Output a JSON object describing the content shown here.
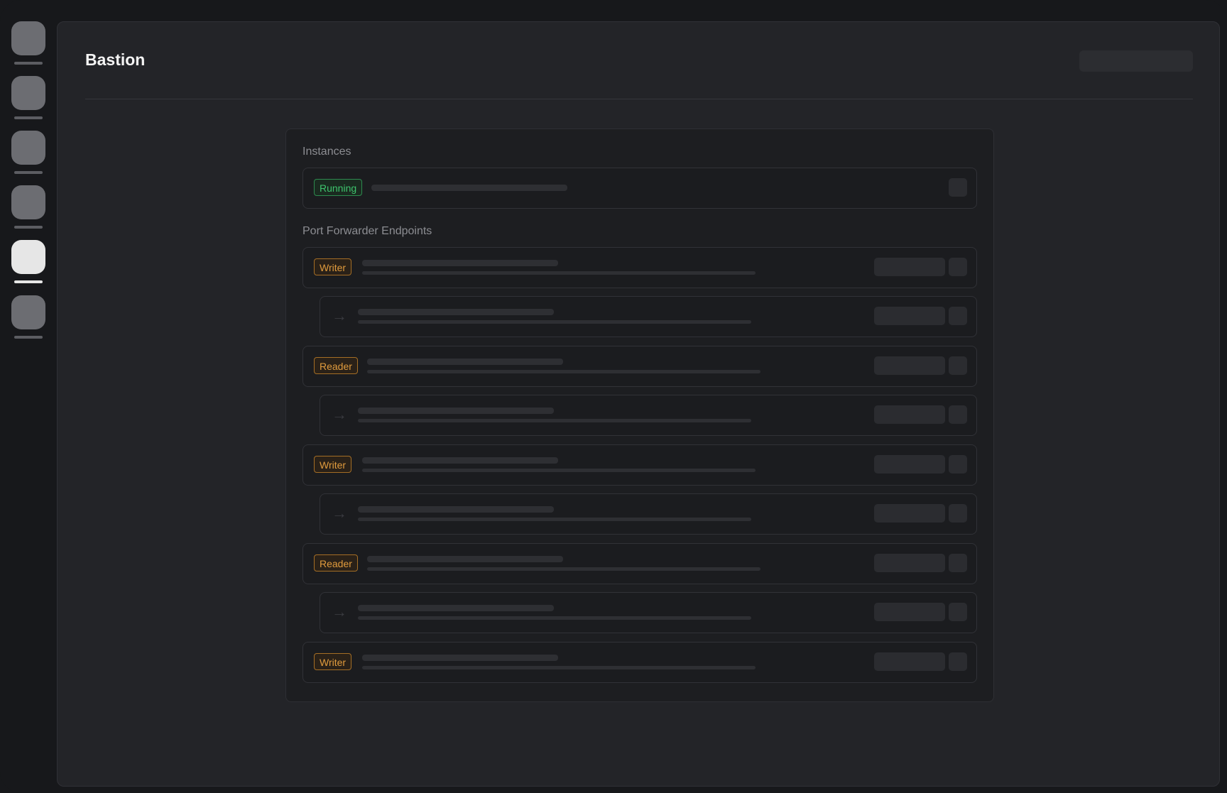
{
  "app": {
    "title": "Bastion"
  },
  "sidebar": {
    "items": [
      {
        "icon": "nav-icon",
        "active": false
      },
      {
        "icon": "nav-icon",
        "active": false
      },
      {
        "icon": "nav-icon",
        "active": false
      },
      {
        "icon": "nav-icon",
        "active": false
      },
      {
        "icon": "nav-icon",
        "active": true
      },
      {
        "icon": "nav-icon",
        "active": false
      }
    ]
  },
  "instances": {
    "label": "Instances",
    "items": [
      {
        "status": "Running"
      }
    ]
  },
  "endpoints": {
    "label": "Port Forwarder Endpoints",
    "items": [
      {
        "role": "Writer"
      },
      {
        "role": "Reader"
      },
      {
        "role": "Writer"
      },
      {
        "role": "Reader"
      },
      {
        "role": "Writer"
      }
    ]
  },
  "colors": {
    "running": "#3ec46d",
    "role": "#e09b3d",
    "active_nav": "#e6e6e6"
  }
}
